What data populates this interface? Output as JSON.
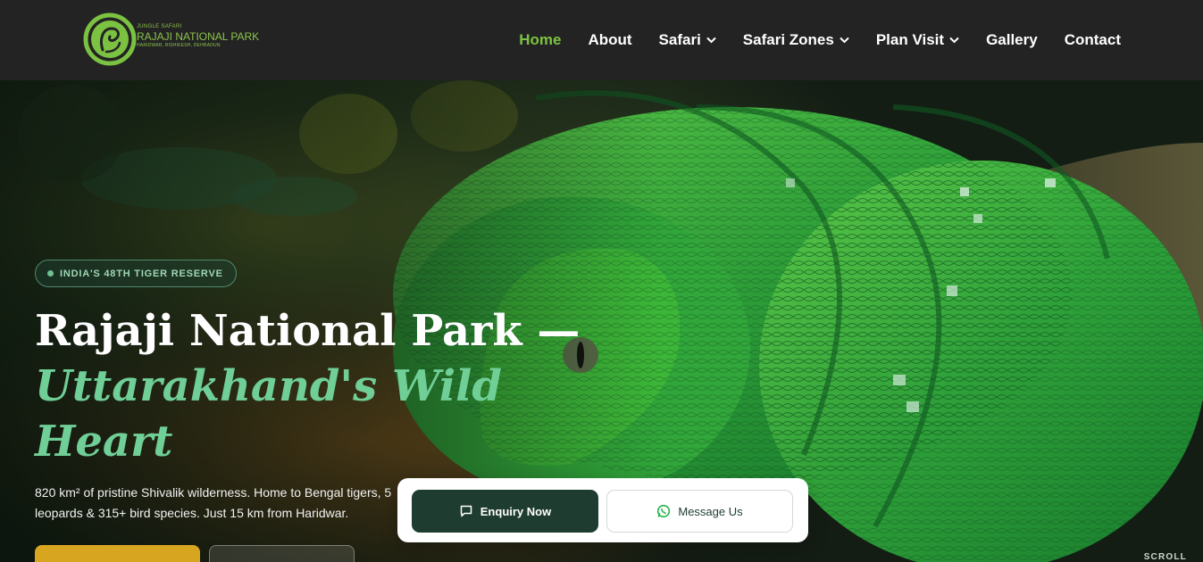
{
  "brand": {
    "tagline": "JUNGLE SAFARI",
    "name": "RAJAJI NATIONAL PARK",
    "locations": "HARIDWAR, RISHIKESH, DEHRADUN",
    "logo_color": "#7cc242"
  },
  "nav": {
    "items": [
      {
        "label": "Home",
        "active": true,
        "has_dropdown": false
      },
      {
        "label": "About",
        "active": false,
        "has_dropdown": false
      },
      {
        "label": "Safari",
        "active": false,
        "has_dropdown": true
      },
      {
        "label": "Safari Zones",
        "active": false,
        "has_dropdown": true
      },
      {
        "label": "Plan Visit",
        "active": false,
        "has_dropdown": true
      },
      {
        "label": "Gallery",
        "active": false,
        "has_dropdown": false
      },
      {
        "label": "Contact",
        "active": false,
        "has_dropdown": false
      }
    ],
    "active_color": "#7cc242"
  },
  "hero": {
    "badge": "INDIA'S 48TH TIGER RESERVE",
    "title_line1": "Rajaji National Park —",
    "title_line2": "Uttarakhand's Wild",
    "title_line3": "Heart",
    "description": "820 km² of pristine Shivalik wilderness. Home to Bengal tigers, 5",
    "description_line2": "leopards & 315+ bird species. Just 15 km from Haridwar.",
    "scroll_label": "SCROLL",
    "accent_color": "#6fcf97",
    "primary_button_color": "#d8a520"
  },
  "cta": {
    "enquiry_label": "Enquiry Now",
    "message_label": "Message Us",
    "enquiry_icon": "chat-bubble-icon",
    "message_icon": "whatsapp-icon",
    "enquiry_bg": "#1e3c30"
  }
}
